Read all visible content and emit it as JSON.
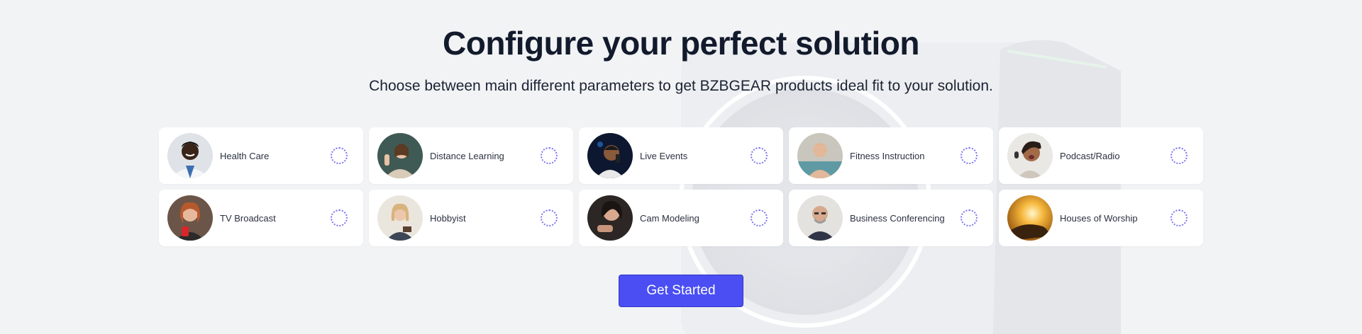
{
  "header": {
    "title": "Configure your perfect solution",
    "subtitle": "Choose between main different parameters to get BZBGEAR products ideal fit to your solution."
  },
  "options": [
    {
      "label": "Health Care",
      "icon": "health-care-avatar"
    },
    {
      "label": "Distance Learning",
      "icon": "distance-learning-avatar"
    },
    {
      "label": "Live Events",
      "icon": "live-events-avatar"
    },
    {
      "label": "Fitness Instruction",
      "icon": "fitness-instruction-avatar"
    },
    {
      "label": "Podcast/Radio",
      "icon": "podcast-radio-avatar"
    },
    {
      "label": "TV Broadcast",
      "icon": "tv-broadcast-avatar"
    },
    {
      "label": "Hobbyist",
      "icon": "hobbyist-avatar"
    },
    {
      "label": "Cam Modeling",
      "icon": "cam-modeling-avatar"
    },
    {
      "label": "Business Conferencing",
      "icon": "business-conferencing-avatar"
    },
    {
      "label": "Houses of Worship",
      "icon": "houses-of-worship-avatar"
    }
  ],
  "cta": {
    "label": "Get Started"
  },
  "colors": {
    "accent": "#4a4ef3",
    "radio_border": "#7b74f2",
    "background": "#f2f3f5",
    "title": "#121a2c"
  }
}
